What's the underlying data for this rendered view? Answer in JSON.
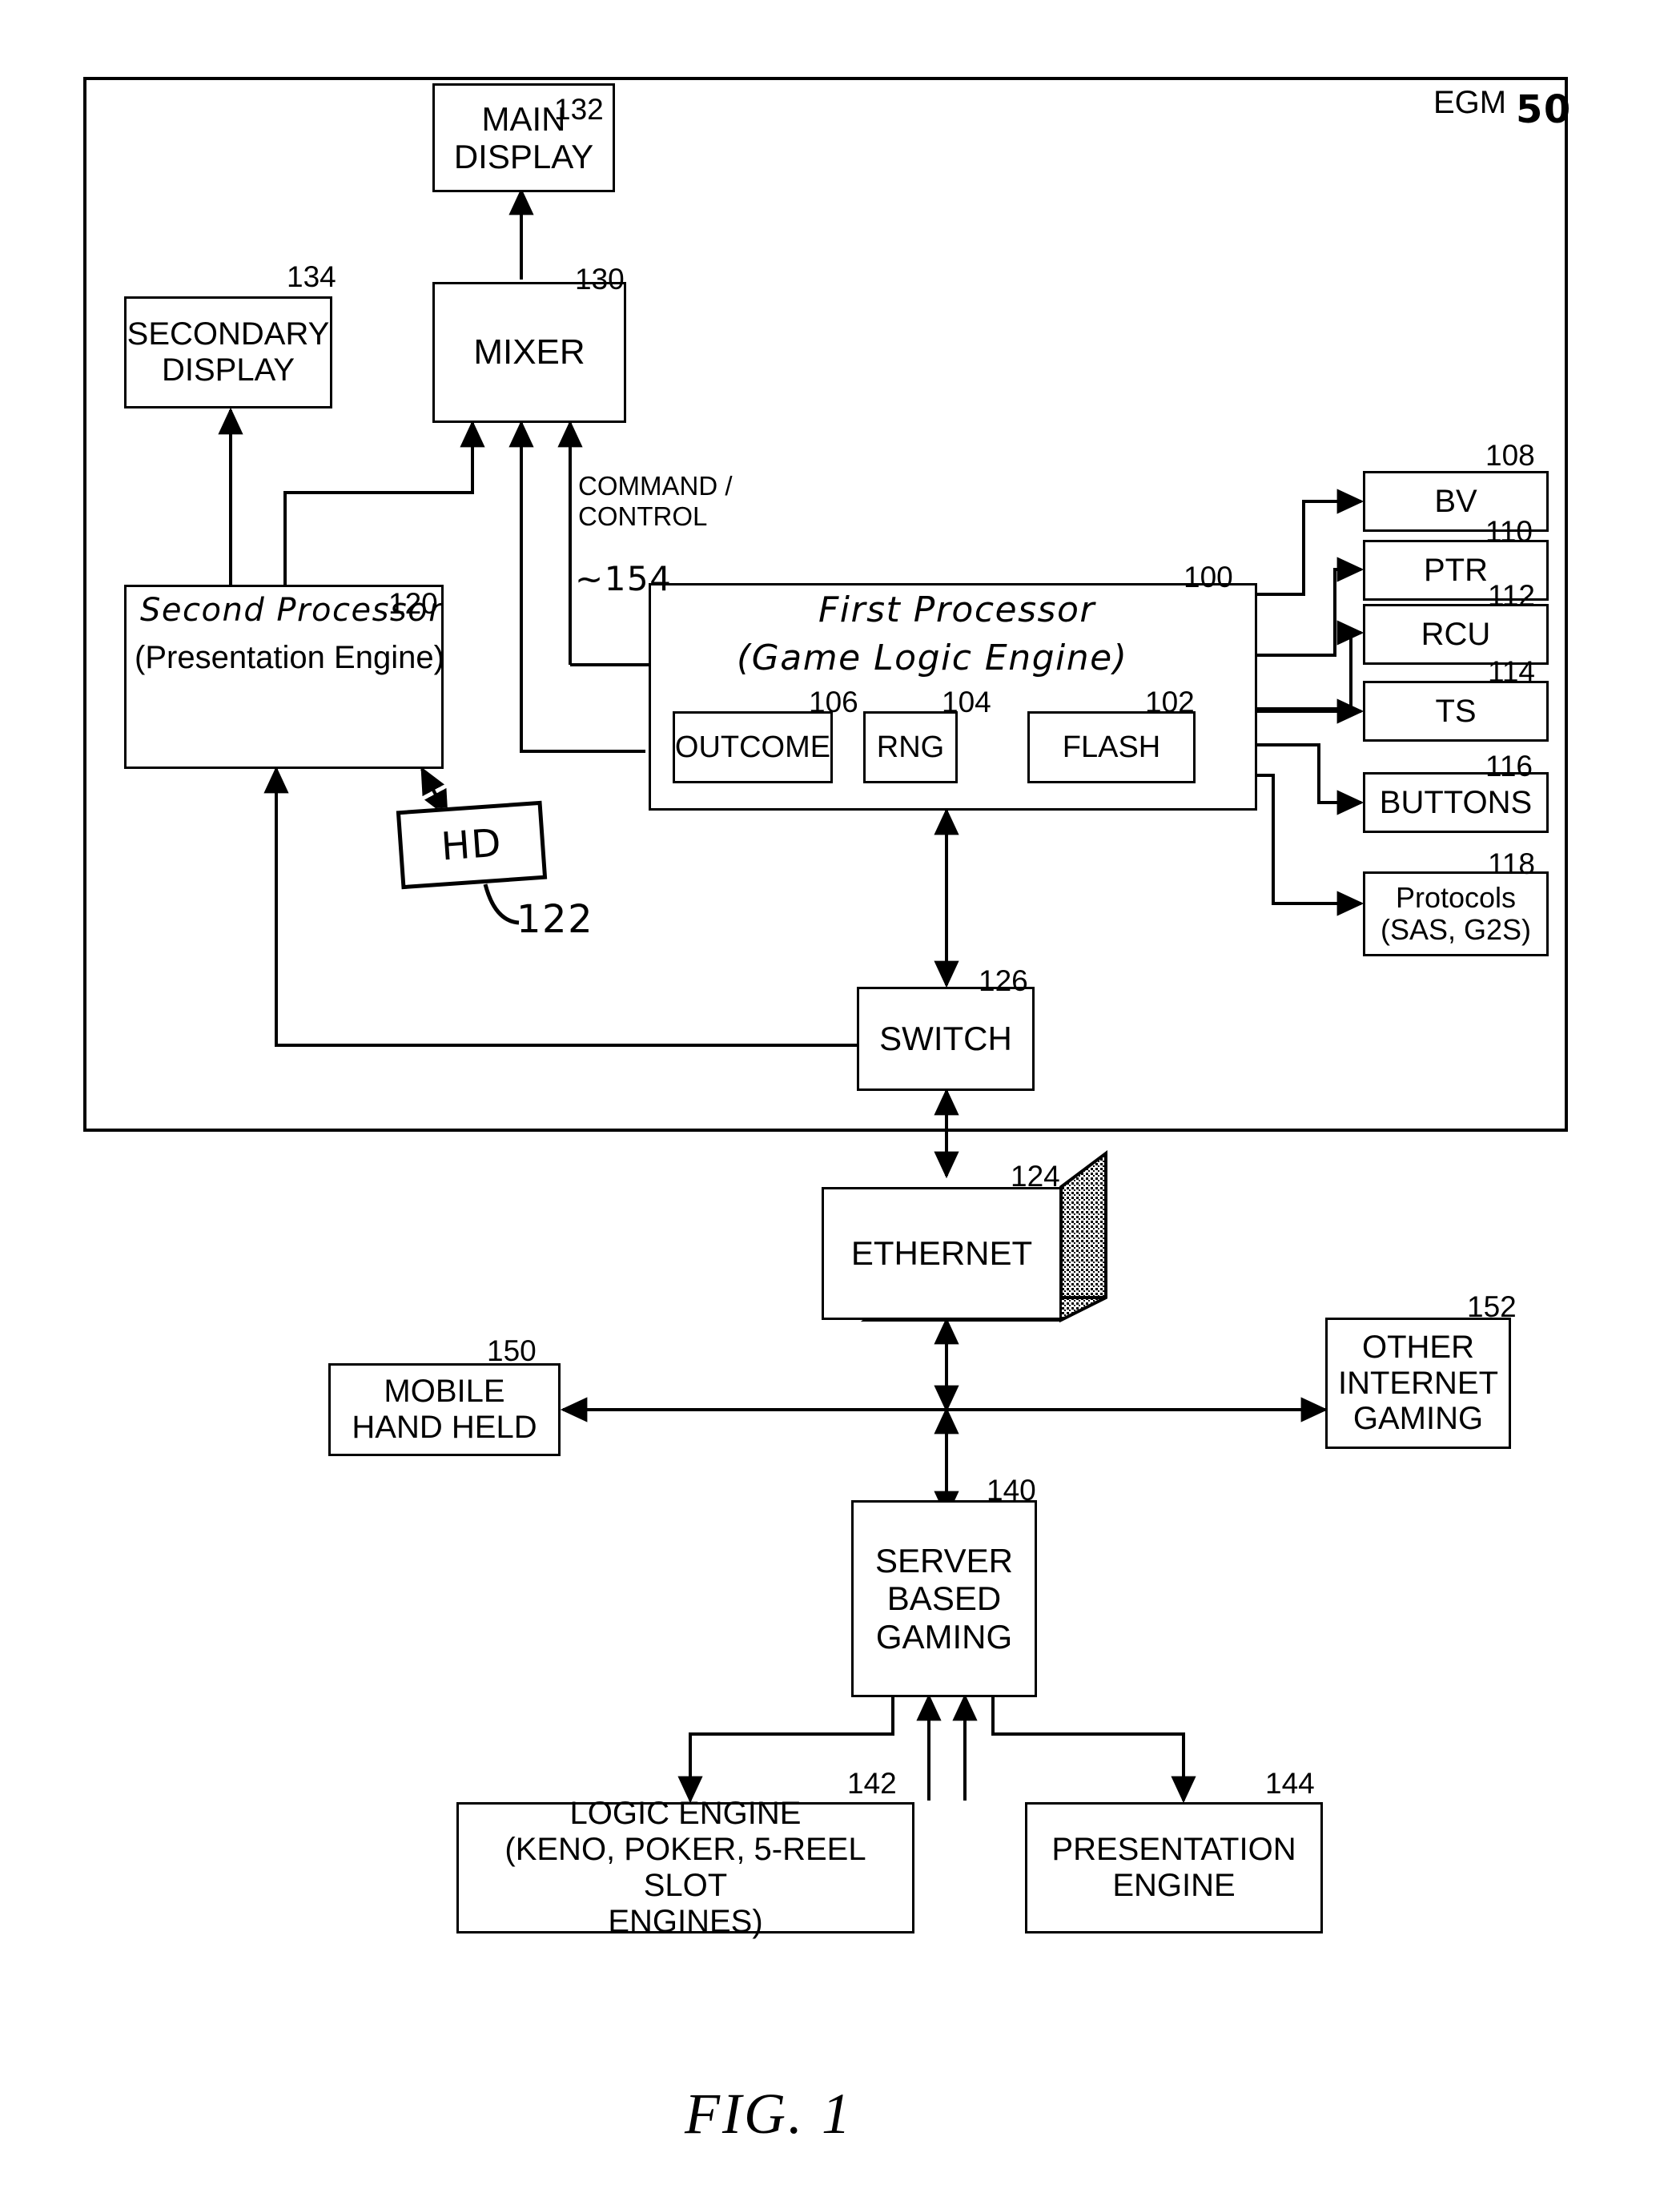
{
  "figure": {
    "caption": "FIG. 1",
    "egm_label": "EGM",
    "egm_ref": "50"
  },
  "blocks": {
    "main_display": {
      "label": "MAIN\nDISPLAY",
      "ref": "132"
    },
    "secondary_display": {
      "label": "SECONDARY\nDISPLAY",
      "ref": "134"
    },
    "mixer": {
      "label": "MIXER",
      "ref": "130"
    },
    "second_processor": {
      "hand_label": "Second Processor",
      "label": "(Presentation Engine)",
      "ref": "120"
    },
    "hd": {
      "label": "HD",
      "ref": "122"
    },
    "first_processor": {
      "hand_label_1": "First Processor",
      "hand_label_2": "(Game Logic Engine)",
      "ref": "100"
    },
    "outcome": {
      "label": "OUTCOME",
      "ref": "106"
    },
    "rng": {
      "label": "RNG",
      "ref": "104"
    },
    "flash": {
      "label": "FLASH",
      "ref": "102"
    },
    "bv": {
      "label": "BV",
      "ref": "108"
    },
    "ptr": {
      "label": "PTR",
      "ref": "110"
    },
    "rcu": {
      "label": "RCU",
      "ref": "112"
    },
    "ts": {
      "label": "TS",
      "ref": "114"
    },
    "buttons": {
      "label": "BUTTONS",
      "ref": "116"
    },
    "protocols": {
      "label": "Protocols\n(SAS, G2S)",
      "ref": "118"
    },
    "switch": {
      "label": "SWITCH",
      "ref": "126"
    },
    "ethernet": {
      "label": "ETHERNET",
      "ref": "124"
    },
    "mobile_hand_held": {
      "label": "MOBILE\nHAND HELD",
      "ref": "150"
    },
    "other_internet_gaming": {
      "label": "OTHER\nINTERNET\nGAMING",
      "ref": "152"
    },
    "server_based_gaming": {
      "label": "SERVER\nBASED\nGAMING",
      "ref": "140"
    },
    "logic_engine": {
      "label": "LOGIC ENGINE\n(KENO, POKER, 5-REEL SLOT\nENGINES)",
      "ref": "142"
    },
    "presentation_engine": {
      "label": "PRESENTATION\nENGINE",
      "ref": "144"
    }
  },
  "annotations": {
    "command_control": "COMMAND /\nCONTROL",
    "ref_154": "~154"
  },
  "colors": {
    "line": "#000000",
    "background": "#ffffff",
    "shading": "#b8b8b8"
  }
}
